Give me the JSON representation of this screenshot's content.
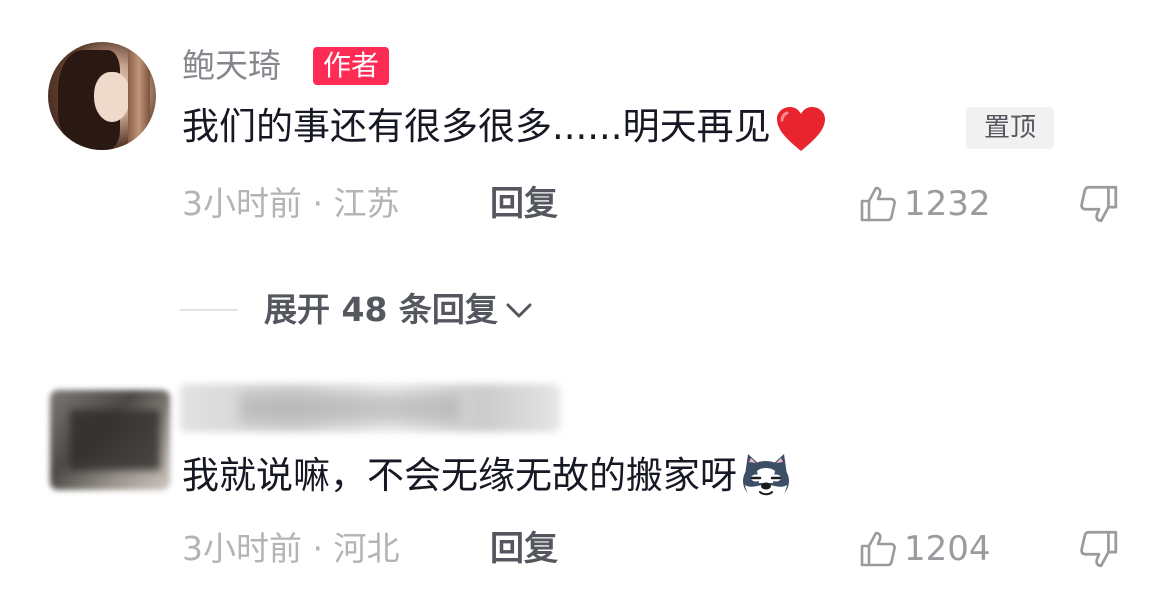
{
  "comments": [
    {
      "author": "鲍天琦",
      "author_badge": "作者",
      "text": "我们的事还有很多很多......明天再见",
      "emoji_icon": "red-heart-icon",
      "pinned_label": "置顶",
      "meta": "3小时前 · 江苏",
      "reply_label": "回复",
      "likes": "1232"
    },
    {
      "author": "",
      "text": "我就说嘛，不会无缘无故的搬家呀",
      "emoji_icon": "husky-dog-emoji-icon",
      "meta": "3小时前 · 河北",
      "reply_label": "回复",
      "likes": "1204"
    }
  ],
  "expand": {
    "label": "展开 48 条回复"
  },
  "colors": {
    "badge_red": "#fe2c55",
    "text_primary": "#161823",
    "text_secondary": "#b3b4b7"
  }
}
